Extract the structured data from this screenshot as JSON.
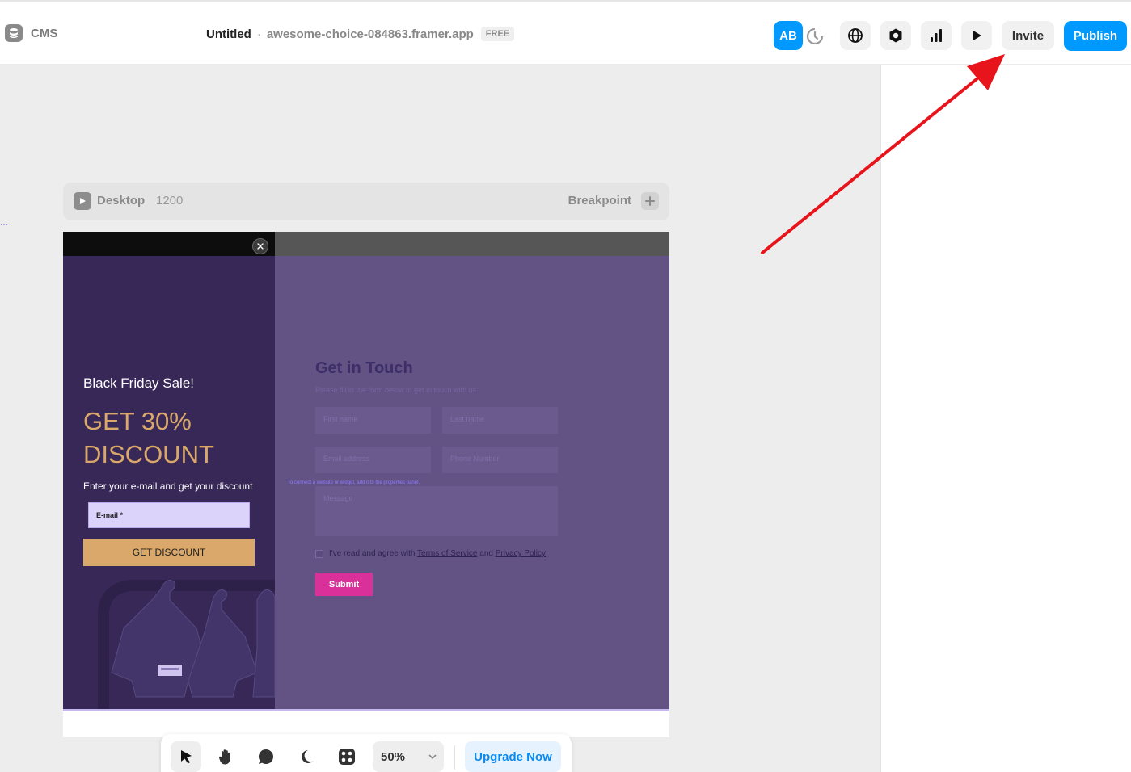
{
  "topbar": {
    "cms_label": "CMS",
    "title": "Untitled",
    "separator": "·",
    "domain": "awesome-choice-084863.framer.app",
    "plan_badge": "FREE",
    "ab_label": "AB",
    "history_icon": "history-icon",
    "globe_icon": "globe-icon",
    "settings_icon": "hexagon-settings-icon",
    "analytics_icon": "bar-chart-icon",
    "preview_icon": "play-icon",
    "invite_label": "Invite",
    "publish_label": "Publish",
    "accent": "#0099ff"
  },
  "canvas": {
    "left_dots": "...",
    "frame_header": {
      "name": "Desktop",
      "width": "1200",
      "breakpoint_label": "Breakpoint"
    }
  },
  "popup": {
    "sale": "Black Friday Sale!",
    "discount": "GET 30% DISCOUNT",
    "prompt": "Enter your e-mail and get your discount",
    "email_label": "E-mail *",
    "button": "GET DISCOUNT",
    "bg_color": "#372858",
    "accent_color": "#d9a86a"
  },
  "form": {
    "title": "Get in Touch",
    "subtitle": "Please fill in the form below to get in touch with us.",
    "first_name": "First name",
    "last_name": "Last name",
    "email": "Email address",
    "phone": "Phone Number",
    "message": "Message",
    "hint": "To connect a website or widget, add it to the properties panel.",
    "agree_prefix": "I've read and agree with",
    "terms": "Terms of Service",
    "and": "and",
    "privacy": "Privacy Policy",
    "submit": "Submit",
    "bg_color": "#635284",
    "submit_color": "#d9309a"
  },
  "toolbar": {
    "tools": [
      "select-arrow-icon",
      "hand-icon",
      "comment-icon",
      "moon-icon",
      "apps-icon"
    ],
    "zoom": "50%",
    "upgrade_label": "Upgrade Now"
  },
  "annotation": {
    "arrow_color": "#e8141b"
  }
}
